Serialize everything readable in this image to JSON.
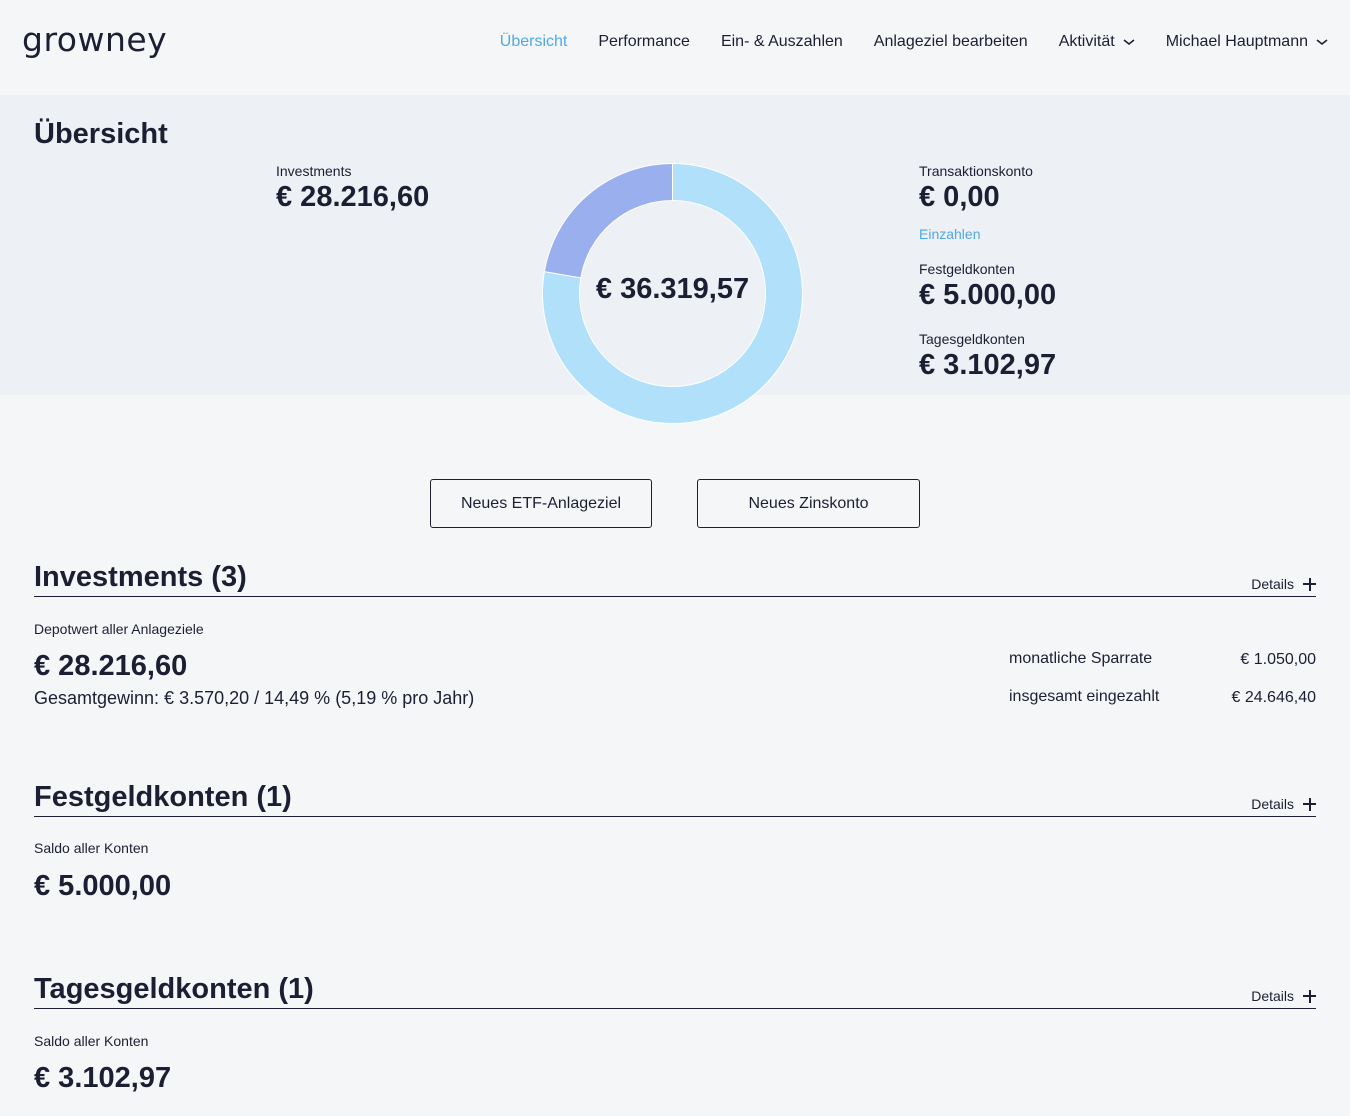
{
  "header": {
    "logo": "growney",
    "nav": [
      {
        "label": "Übersicht"
      },
      {
        "label": "Performance"
      },
      {
        "label": "Ein- & Auszahlen"
      },
      {
        "label": "Anlageziel bearbeiten"
      },
      {
        "label": "Aktivität"
      },
      {
        "label": "Michael Hauptmann"
      }
    ]
  },
  "overview": {
    "title": "Übersicht",
    "investments_label": "Investments",
    "investments_value": "€ 28.216,60",
    "total_value": "€ 36.319,57",
    "transaktionskonto_label": "Transaktionskonto",
    "transaktionskonto_value": "€ 0,00",
    "einzahlen_link": "Einzahlen",
    "festgeld_label": "Festgeldkonten",
    "festgeld_value": "€ 5.000,00",
    "tagesgeld_label": "Tagesgeldkonten",
    "tagesgeld_value": "€ 3.102,97"
  },
  "chart_data": {
    "type": "pie",
    "variant": "donut",
    "segments": [
      {
        "value": 28216.6,
        "color": "#b0e0fa"
      },
      {
        "value": 8102.97,
        "color": "#9ab0ee"
      }
    ]
  },
  "actions": {
    "new_etf": "Neues ETF-Anlageziel",
    "new_zins": "Neues Zinskonto"
  },
  "investments": {
    "title": "Investments (3)",
    "details": "Details",
    "sub_label": "Depotwert aller Anlageziele",
    "value": "€ 28.216,60",
    "gain": "Gesamtgewinn: € 3.570,20 / 14,49 % (5,19 % pro Jahr)",
    "sparrate_label": "monatliche Sparrate",
    "sparrate_value": "€ 1.050,00",
    "eingezahlt_label": "insgesamt eingezahlt",
    "eingezahlt_value": "€ 24.646,40"
  },
  "festgeld": {
    "title": "Festgeldkonten (1)",
    "details": "Details",
    "sub_label": "Saldo aller Konten",
    "value": "€ 5.000,00"
  },
  "tagesgeld": {
    "title": "Tagesgeldkonten (1)",
    "details": "Details",
    "sub_label": "Saldo aller Konten",
    "value": "€ 3.102,97"
  },
  "colors": {
    "accent": "#4fa9e8",
    "text": "#1c1f33",
    "band": "#edf0f4"
  }
}
